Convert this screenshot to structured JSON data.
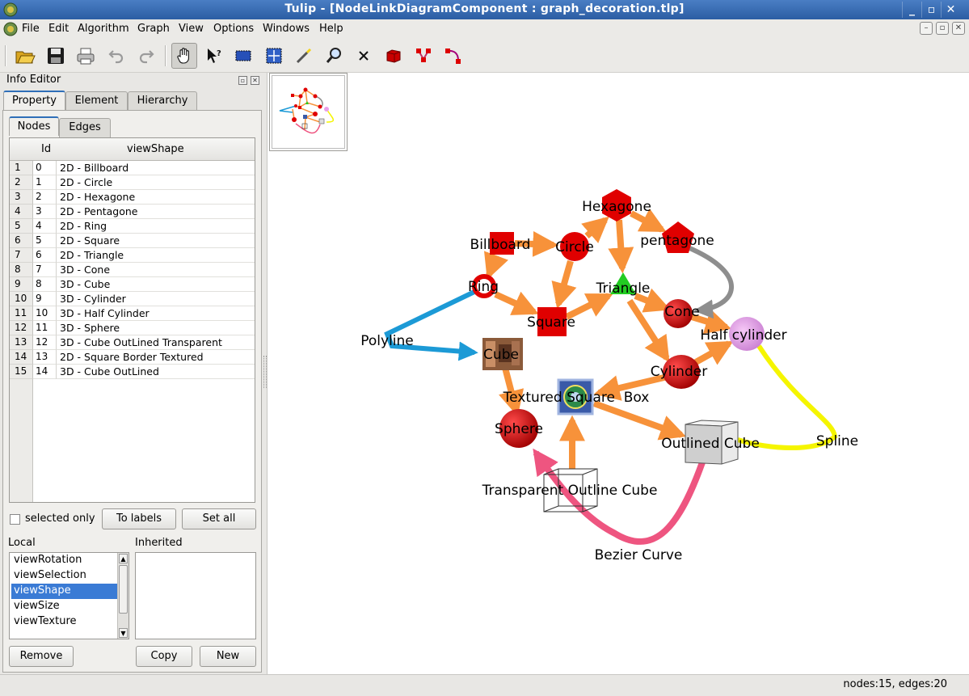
{
  "window": {
    "title": "Tulip - [NodeLinkDiagramComponent : graph_decoration.tlp]",
    "controls": [
      "_",
      "▫",
      "✕"
    ]
  },
  "menu": {
    "items": [
      "File",
      "Edit",
      "Algorithm",
      "Graph",
      "View",
      "Options",
      "Windows",
      "Help"
    ]
  },
  "toolbar": {
    "buttons": [
      "open-icon",
      "save-icon",
      "print-icon",
      "undo-icon",
      "redo-icon",
      "navigate-hand-icon",
      "get-info-icon",
      "select-rectangle-icon",
      "selection-icon",
      "magic-wand-icon",
      "zoom-icon",
      "delete-icon",
      "add-node-icon",
      "add-edge-icon",
      "edit-edge-bends-icon"
    ],
    "active": "navigate-hand-icon"
  },
  "info_editor": {
    "title": "Info Editor",
    "tabs": [
      "Property",
      "Element",
      "Hierarchy"
    ],
    "subtabs": [
      "Nodes",
      "Edges"
    ],
    "table": {
      "columns": [
        "Id",
        "viewShape"
      ],
      "rows": [
        {
          "n": "1",
          "id": "0",
          "shape": "2D - Billboard"
        },
        {
          "n": "2",
          "id": "1",
          "shape": "2D - Circle"
        },
        {
          "n": "3",
          "id": "2",
          "shape": "2D - Hexagone"
        },
        {
          "n": "4",
          "id": "3",
          "shape": "2D - Pentagone"
        },
        {
          "n": "5",
          "id": "4",
          "shape": "2D - Ring"
        },
        {
          "n": "6",
          "id": "5",
          "shape": "2D - Square"
        },
        {
          "n": "7",
          "id": "6",
          "shape": "2D - Triangle"
        },
        {
          "n": "8",
          "id": "7",
          "shape": "3D - Cone"
        },
        {
          "n": "9",
          "id": "8",
          "shape": "3D - Cube"
        },
        {
          "n": "10",
          "id": "9",
          "shape": "3D - Cylinder"
        },
        {
          "n": "11",
          "id": "10",
          "shape": "3D - Half Cylinder"
        },
        {
          "n": "12",
          "id": "11",
          "shape": "3D - Sphere"
        },
        {
          "n": "13",
          "id": "12",
          "shape": "3D - Cube OutLined Transparent"
        },
        {
          "n": "14",
          "id": "13",
          "shape": "2D - Square Border Textured"
        },
        {
          "n": "15",
          "id": "14",
          "shape": "3D - Cube OutLined"
        }
      ]
    },
    "selected_only": "selected only",
    "to_labels": "To labels",
    "set_all": "Set all",
    "local_label": "Local",
    "inherited_label": "Inherited",
    "local_props": [
      "viewRotation",
      "viewSelection",
      "viewShape",
      "viewSize",
      "viewTexture"
    ],
    "selected_prop": "viewShape",
    "remove": "Remove",
    "copy": "Copy",
    "new": "New"
  },
  "graph": {
    "node_labels": {
      "billboard": "Billboard",
      "circle": "Circle",
      "hexagone": "Hexagone",
      "pentagone": "pentagone",
      "ring": "Ring",
      "square": "Square",
      "triangle": "Triangle",
      "cone": "Cone",
      "cube": "Cube",
      "cylinder": "Cylinder",
      "half_cylinder": "Half cylinder",
      "sphere": "Sphere",
      "transparent_cube": "Transparent Outline Cube",
      "textured_square": "Textured Square  Box",
      "outlined_cube": "Outlined Cube"
    },
    "edge_labels": {
      "polyline": "Polyline",
      "spline": "Spline",
      "bezier": "Bezier Curve"
    },
    "colors": {
      "node_red": "#e00000",
      "edge_orange": "#f7923a",
      "edge_blue": "#1c9ad6",
      "edge_yellow": "#f5f500",
      "edge_pink": "#ee5580",
      "edge_gray": "#8e8e8e",
      "triangle_green": "#22cc22",
      "half_cylinder": "#e9a0e9"
    }
  },
  "status": {
    "text": "nodes:15, edges:20"
  }
}
